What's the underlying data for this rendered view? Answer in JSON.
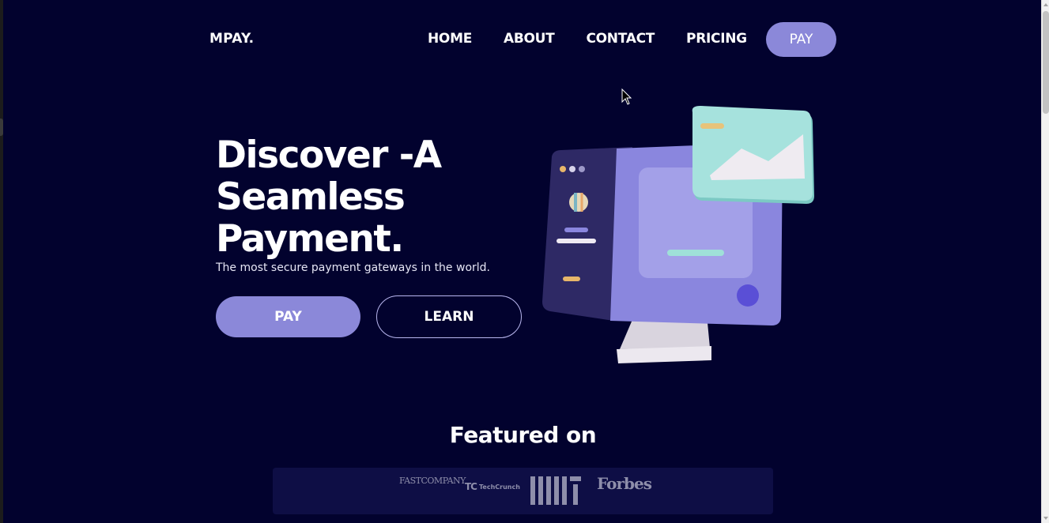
{
  "header": {
    "logo": "MPAY.",
    "nav": [
      "HOME",
      "ABOUT",
      "CONTACT",
      "PRICING"
    ],
    "pay_label": "PAY"
  },
  "hero": {
    "title_line1": "Discover -A",
    "title_line2": "Seamless",
    "title_line3": "Payment.",
    "subtitle": "The most secure payment gateways in the world.",
    "pay_label": "PAY",
    "learn_label": "LEARN"
  },
  "featured": {
    "title": "Featured on",
    "logos": [
      "FASTCOMPANY",
      "TechCrunch",
      "MIT",
      "Forbes"
    ]
  },
  "colors": {
    "background": "#02022e",
    "accent": "#8b88d9",
    "strip": "#0e0e45"
  }
}
